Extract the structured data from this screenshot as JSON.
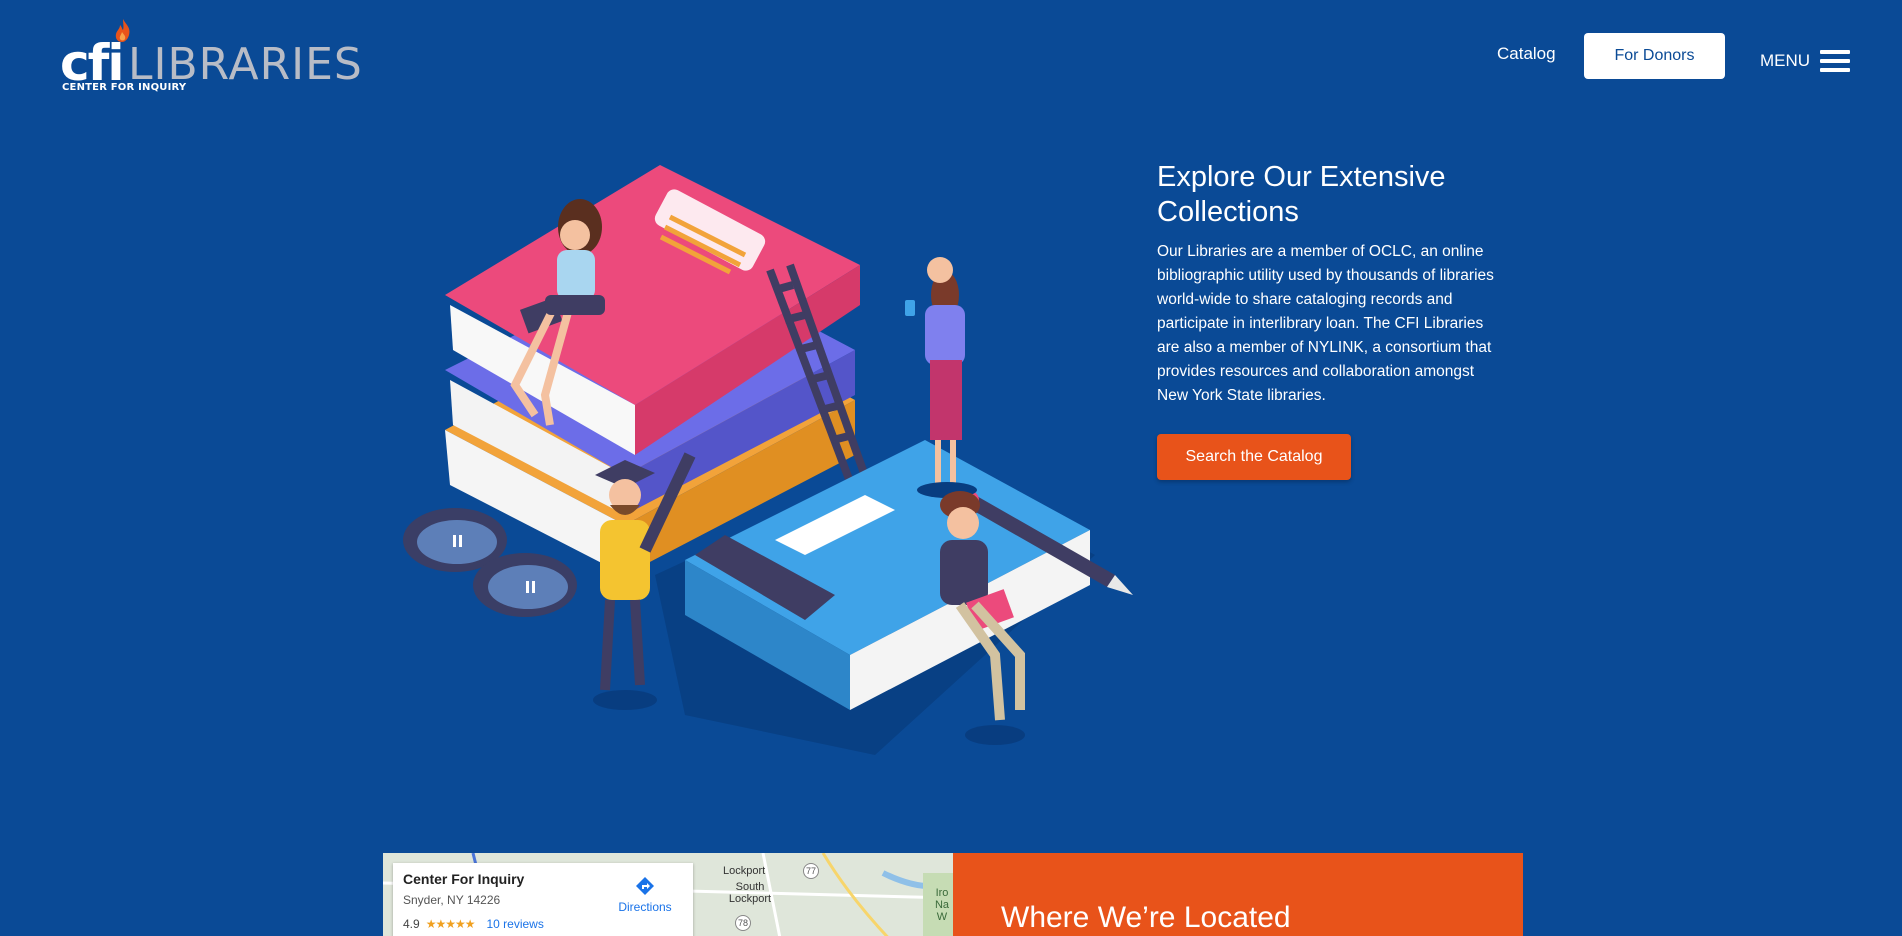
{
  "header": {
    "logo_cfi": "cfi",
    "logo_libraries": "LIBRARIES",
    "logo_subtitle": "CENTER FOR INQUIRY",
    "nav_catalog": "Catalog",
    "nav_donors": "For Donors",
    "nav_menu": "MENU"
  },
  "hero": {
    "title": "Explore Our Extensive Collections",
    "body": "Our Libraries are a member of OCLC, an online bibliographic utility used by thousands of libraries world-wide to share cataloging records and participate in interlibrary loan. The CFI Libraries are also a member of NYLINK, a consortium that provides resources and collaboration amongst New York State libraries.",
    "cta": "Search the Catalog"
  },
  "map": {
    "place_name": "Center For Inquiry",
    "address": "Snyder, NY 14226",
    "rating": "4.9",
    "stars": "★★★★★",
    "reviews": "10 reviews",
    "directions": "Directions",
    "town_1": "Lockport",
    "town_2": "South Lockport",
    "road_1": "77",
    "road_2": "78",
    "edge_label": "Iro Na W"
  },
  "location": {
    "title": "Where We’re Located"
  },
  "colors": {
    "background": "#0a4a96",
    "accent_orange": "#e8531a",
    "white": "#ffffff"
  }
}
